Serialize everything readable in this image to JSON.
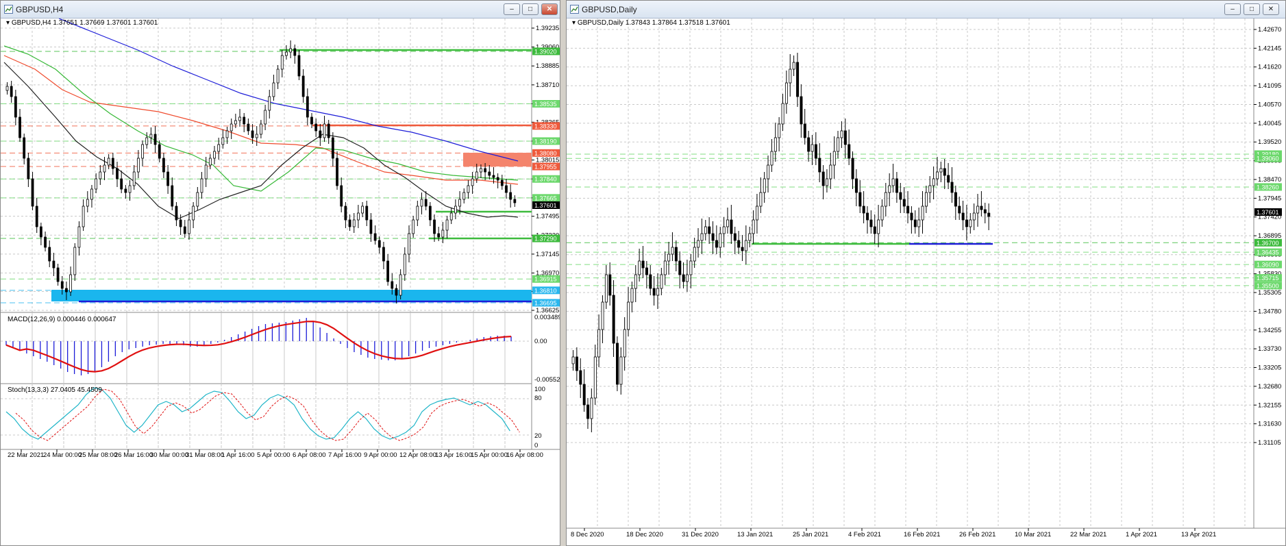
{
  "windows": [
    {
      "title": "GBPUSD,H4"
    },
    {
      "title": "GBPUSD,Daily"
    }
  ],
  "window_buttons": {
    "minimize": "–",
    "maximize": "□",
    "close": "✕"
  },
  "h4": {
    "header": "GBPUSD,H4  1.37651 1.37669 1.37601 1.37601",
    "current": "1.37601",
    "price_ticks": [
      "1.39235",
      "1.39060",
      "1.38885",
      "1.38710",
      "1.38535",
      "1.38365",
      "1.38190",
      "1.38015",
      "1.37840",
      "1.37665",
      "1.37495",
      "1.37320",
      "1.37145",
      "1.36970",
      "1.36800",
      "1.36625"
    ],
    "levels": [
      {
        "label": "1.39020",
        "color": "#3dbb3d"
      },
      {
        "label": "1.38535",
        "color": "#6cd86c"
      },
      {
        "label": "1.38330",
        "color": "#ef5a3c"
      },
      {
        "label": "1.38190",
        "color": "#6cd86c"
      },
      {
        "label": "1.38080",
        "color": "#ef5a3c"
      },
      {
        "label": "1.37955",
        "color": "#ef5a3c"
      },
      {
        "label": "1.37840",
        "color": "#6cd86c"
      },
      {
        "label": "1.37665",
        "color": "#6cd86c"
      },
      {
        "label": "1.37290",
        "color": "#3dbb3d"
      },
      {
        "label": "1.36915",
        "color": "#6cd86c"
      },
      {
        "label": "1.36810",
        "color": "#29b7ee"
      },
      {
        "label": "1.36695",
        "color": "#29b7ee"
      }
    ],
    "time_labels": [
      "22 Mar 2021",
      "24 Mar 00:00",
      "25 Mar 08:00",
      "26 Mar 16:00",
      "30 Mar 00:00",
      "31 Mar 08:00",
      "1 Apr 16:00",
      "5 Apr 00:00",
      "6 Apr 08:00",
      "7 Apr 16:00",
      "9 Apr 00:00",
      "12 Apr 08:00",
      "13 Apr 16:00",
      "15 Apr 00:00",
      "16 Apr 08:00"
    ],
    "macd": {
      "header": "MACD(12,26,9) 0.000446 0.000647",
      "ticks": [
        "0.003489",
        "0.00",
        "-0.005524"
      ]
    },
    "stoch": {
      "header": "Stoch(13,3,3) 27.0405 45.4509",
      "ticks": [
        "100",
        "80",
        "20",
        "0"
      ]
    }
  },
  "daily": {
    "header": "GBPUSD,Daily  1.37843 1.37864 1.37518 1.37601",
    "current": "1.37601",
    "price_ticks": [
      "1.42670",
      "1.42145",
      "1.41620",
      "1.41095",
      "1.40570",
      "1.40045",
      "1.39520",
      "1.38995",
      "1.38470",
      "1.37945",
      "1.37420",
      "1.36895",
      "1.36365",
      "1.35830",
      "1.35305",
      "1.34780",
      "1.34255",
      "1.33730",
      "1.33205",
      "1.32680",
      "1.32155",
      "1.31630",
      "1.31105"
    ],
    "levels": [
      {
        "label": "1.39180",
        "color": "#6cd86c"
      },
      {
        "label": "1.39060",
        "color": "#6cd86c"
      },
      {
        "label": "1.38260",
        "color": "#6cd86c"
      },
      {
        "label": "1.36700",
        "color": "#3dbb3d"
      },
      {
        "label": "1.36435",
        "color": "#6cd86c"
      },
      {
        "label": "1.36090",
        "color": "#6cd86c"
      },
      {
        "label": "1.35715",
        "color": "#6cd86c"
      },
      {
        "label": "1.35500",
        "color": "#6cd86c"
      }
    ],
    "time_labels": [
      "8 Dec 2020",
      "18 Dec 2020",
      "31 Dec 2020",
      "13 Jan 2021",
      "25 Jan 2021",
      "4 Feb 2021",
      "16 Feb 2021",
      "26 Feb 2021",
      "10 Mar 2021",
      "22 Mar 2021",
      "1 Apr 2021",
      "13 Apr 2021"
    ]
  }
}
